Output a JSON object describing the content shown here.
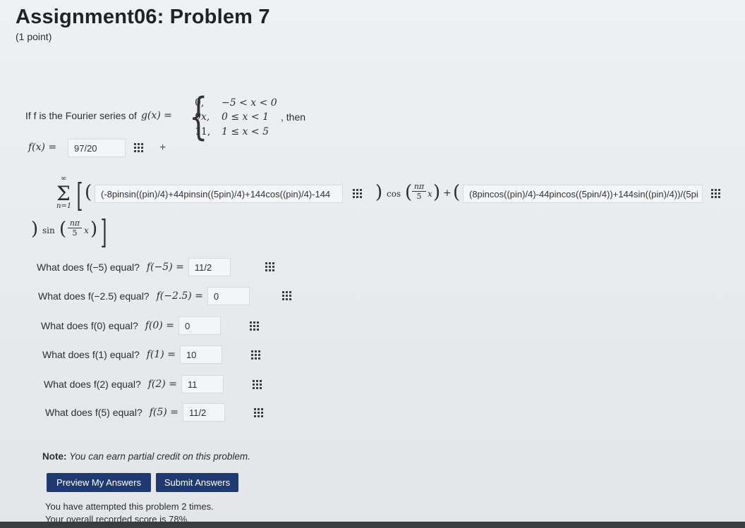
{
  "problem": {
    "title": "Assignment06: Problem 7",
    "points": "(1 point)"
  },
  "intro": {
    "prefix": "If f is the Fourier series of",
    "g_expr": "g(x) =",
    "pieces": [
      {
        "value": "0,",
        "condition": "−5 < x < 0"
      },
      {
        "value": "9x,",
        "condition": "0 ≤ x < 1"
      },
      {
        "value": "11,",
        "condition": "1 ≤ x < 5"
      }
    ],
    "suffix": ", then"
  },
  "series": {
    "f_label": "f(x) =",
    "a0_value": "97/20",
    "plus": "+",
    "sum_top": "∞",
    "sum_bottom": "n=1",
    "an_value": "(-8pinsin((pin)/4)+44pinsin((5pin)/4)+144cos((pin)/4)-144",
    "cos_label": "cos",
    "bn_value": "(8pincos((pin)/4)-44pincos((5pin/4))+144sin((pin)/4))/(5pi",
    "sin_label": "sin",
    "frac_num": "nπ",
    "frac_den": "5",
    "x_var": "x"
  },
  "questions": [
    {
      "text": "What does f(−5) equal?",
      "math": "f(−5) =",
      "answer": "11/2"
    },
    {
      "text": "What does f(−2.5) equal?",
      "math": "f(−2.5) =",
      "answer": "0"
    },
    {
      "text": "What does f(0) equal?",
      "math": "f(0) =",
      "answer": "0"
    },
    {
      "text": "What does f(1) equal?",
      "math": "f(1) =",
      "answer": "10"
    },
    {
      "text": "What does f(2) equal?",
      "math": "f(2) =",
      "answer": "11"
    },
    {
      "text": "What does f(5) equal?",
      "math": "f(5) =",
      "answer": "11/2"
    }
  ],
  "note": {
    "label": "Note:",
    "text": "You can earn partial credit on this problem."
  },
  "buttons": {
    "preview": "Preview My Answers",
    "submit": "Submit Answers"
  },
  "status": {
    "attempts": "You have attempted this problem 2 times.",
    "score": "Your overall recorded score is 78%."
  }
}
